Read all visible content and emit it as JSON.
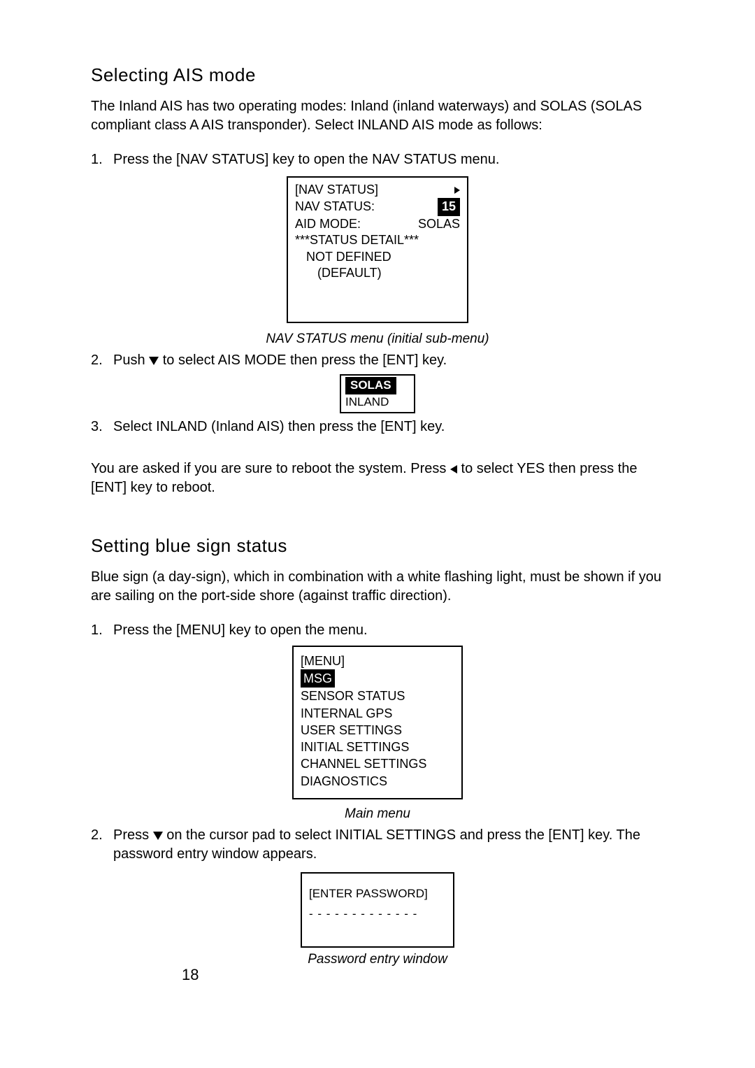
{
  "section1": {
    "heading": "Selecting AIS mode",
    "intro": "The Inland AIS has two operating modes: Inland (inland waterways) and SOLAS (SOLAS compliant class A AIS transponder). Select INLAND AIS mode as follows:",
    "step1": "Press the [NAV STATUS] key to open the NAV STATUS menu.",
    "screen1": {
      "title": "[NAV STATUS]",
      "row_navstatus_label": "NAV STATUS:",
      "row_navstatus_value": "15",
      "row_aidmode_label": "AID MODE:",
      "row_aidmode_value": "SOLAS",
      "status_header": "***STATUS DETAIL***",
      "status_l1": "NOT DEFINED",
      "status_l2": "(DEFAULT)"
    },
    "caption1": "NAV STATUS menu (initial sub-menu)",
    "step2_a": "Push ",
    "step2_b": " to select AIS MODE then press the [ENT] key.",
    "popup": {
      "opt1": "SOLAS",
      "opt2": "INLAND"
    },
    "step3": "Select INLAND (Inland AIS) then press the [ENT] key.",
    "post_a": "You are asked if you are sure to reboot the system. Press ",
    "post_b": " to select YES then press the [ENT] key to reboot."
  },
  "section2": {
    "heading": "Setting blue sign status",
    "intro": "Blue sign (a day-sign), which in combination with a white flashing light, must be shown if you are sailing on the port-side shore (against traffic direction).",
    "step1": "Press the [MENU] key to open the menu.",
    "menu": {
      "title": "[MENU]",
      "i1_sel": "MSG",
      "i2": "SENSOR STATUS",
      "i3": "INTERNAL GPS",
      "i4": "USER SETTINGS",
      "i5": "INITIAL SETTINGS",
      "i6": "CHANNEL SETTINGS",
      "i7": "DIAGNOSTICS"
    },
    "caption2": "Main menu",
    "step2_a": "Press ",
    "step2_b": " on the cursor pad to select INITIAL SETTINGS and press the [ENT] key. The password entry window appears.",
    "pwbox": {
      "title": "[ENTER PASSWORD]",
      "dashes": "- - - - - - - - - - - - -"
    },
    "caption3": "Password entry window"
  },
  "page_number": "18"
}
